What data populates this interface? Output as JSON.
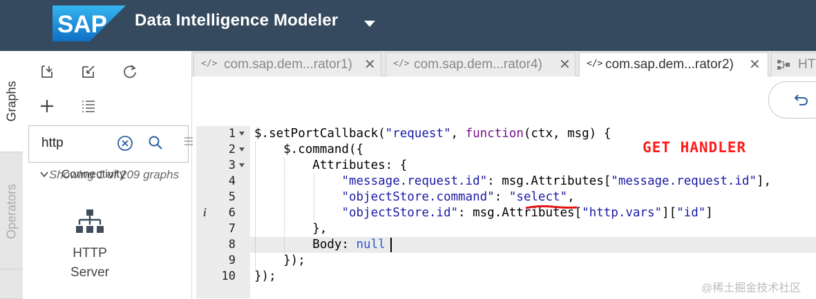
{
  "header": {
    "logo_text": "SAP",
    "app_title": "Data Intelligence Modeler"
  },
  "vertical_tabs": [
    "Graphs",
    "Operators"
  ],
  "sidebar": {
    "search_value": "http",
    "group_label": "Connectivity",
    "overlapping_text": "Showing 1 of 209 graphs",
    "operator": {
      "label_line1": "HTTP",
      "label_line2": "Server"
    }
  },
  "tabs": [
    {
      "label": "com.sap.dem...rator1)",
      "icon": "code-icon",
      "active": false
    },
    {
      "label": "com.sap.dem...rator4)",
      "icon": "code-icon",
      "active": false
    },
    {
      "label": "com.sap.dem...rator2)",
      "icon": "code-icon",
      "active": true
    },
    {
      "label": "HT",
      "icon": "graph-icon",
      "active": false
    }
  ],
  "tab_icon_text": "</>",
  "tab_close_glyph": "✕",
  "editor": {
    "lines": [
      {
        "n": "1",
        "text": "$.setPortCallback(\"request\", function(ctx, msg) {"
      },
      {
        "n": "2",
        "text": "    $.command({"
      },
      {
        "n": "3",
        "text": "        Attributes: {"
      },
      {
        "n": "4",
        "text": "            \"message.request.id\": msg.Attributes[\"message.request.id\"],"
      },
      {
        "n": "5",
        "text": "            \"objectStore.command\": \"select\","
      },
      {
        "n": "6",
        "text": "            \"objectStore.id\": msg.Attributes[\"http.vars\"][\"id\"]"
      },
      {
        "n": "7",
        "text": "        },"
      },
      {
        "n": "8",
        "text": "        Body: null"
      },
      {
        "n": "9",
        "text": "    });"
      },
      {
        "n": "10",
        "text": "});"
      }
    ],
    "info_marker": "i",
    "annotation": "GET HANDLER"
  },
  "watermark": "@稀土掘金技术社区",
  "colors": {
    "shell": "#354a5f",
    "keyword": "#7a0f8f",
    "string": "#1a1aa6",
    "null": "#2b55d8",
    "annotation": "#ff1a1a",
    "brand_blue": "#1da1f2"
  }
}
